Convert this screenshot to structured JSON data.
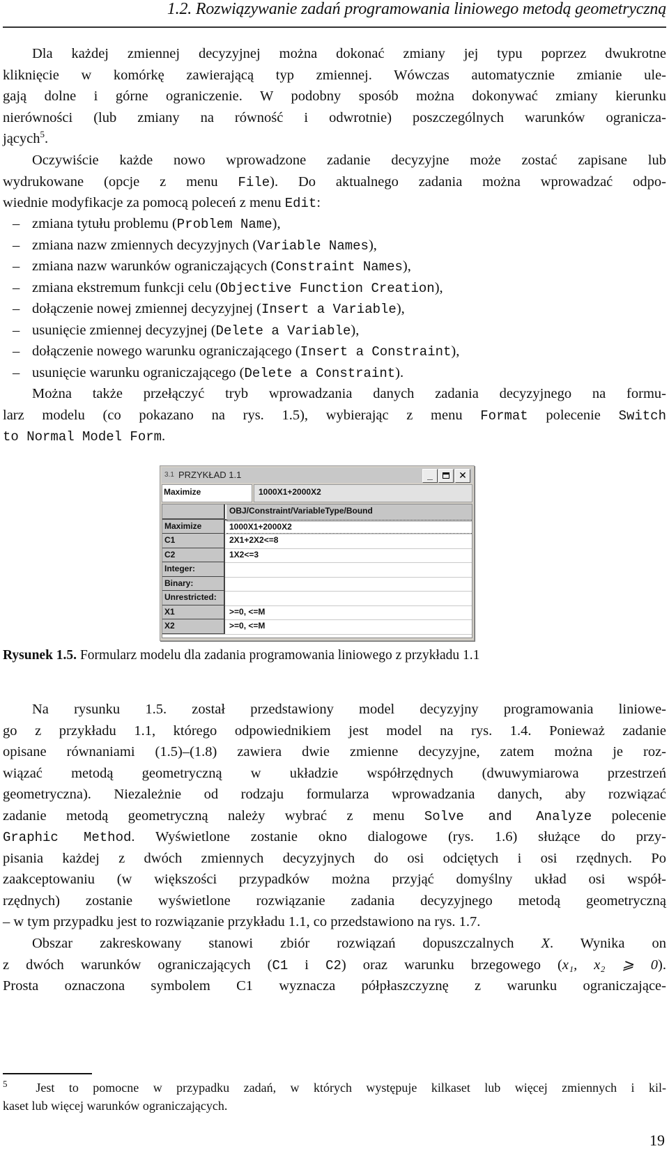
{
  "header": {
    "title": "1.2. Rozwiązywanie zadań programowania liniowego metodą geometryczną"
  },
  "para1": {
    "lines": [
      "Dla każdej zmiennej decyzyjnej można dokonać zmiany jej typu poprzez dwukrotne",
      "kliknięcie w komórkę zawierającą typ zmiennej. Wówczas automatycznie zmianie ule-",
      "gają dolne i górne ograniczenie. W podobny sposób można dokonywać zmiany kierunku",
      "nierówności (lub zmiany na równość i odwrotnie) poszczególnych warunków ogranicza-"
    ],
    "last_line": "jących",
    "footnote_ref": "5",
    "last_line_end": "."
  },
  "para2": {
    "line1": "Oczywiście każde nowo wprowadzone zadanie decyzyjne może zostać zapisane lub",
    "line2_a": "wydrukowane (opcje z menu ",
    "line2_code": "File",
    "line2_b": "). Do aktualnego zadania można wprowadzać odpo-",
    "line3_a": "wiednie modyfikacje za pomocą poleceń z menu ",
    "line3_code": "Edit",
    "line3_b": ":"
  },
  "edit_list": [
    {
      "text": "zmiana tytułu problemu (",
      "code": "Problem Name",
      "end": "),"
    },
    {
      "text": "zmiana nazw zmiennych decyzyjnych (",
      "code": "Variable Names",
      "end": "),"
    },
    {
      "text": "zmiana nazw warunków ograniczających (",
      "code": "Constraint Names",
      "end": "),"
    },
    {
      "text": "zmiana ekstremum funkcji celu (",
      "code": "Objective Function Creation",
      "end": "),"
    },
    {
      "text": "dołączenie nowej zmiennej decyzyjnej (",
      "code": "Insert a Variable",
      "end": "),"
    },
    {
      "text": "usunięcie zmiennej decyzyjnej (",
      "code": "Delete a Variable",
      "end": "),"
    },
    {
      "text": "dołączenie nowego warunku ograniczającego (",
      "code": "Insert a Constraint",
      "end": "),"
    },
    {
      "text": "usunięcie warunku ograniczającego (",
      "code": "Delete a Constraint",
      "end": ")."
    }
  ],
  "list_dash": "–",
  "para3": {
    "line1": "Można także przełączyć tryb wprowadzania danych zadania decyzyjnego na formu-",
    "line2_a": "larz modelu (co pokazano na rys. 1.5), wybierając z menu ",
    "line2_code1": "Format",
    "line2_b": " polecenie ",
    "line2_code2": "Switch",
    "line3_code": "to Normal Model Form",
    "line3_end": "."
  },
  "window": {
    "icon": "3.1",
    "title": "PRZYKŁAD 1.1",
    "buttons": {
      "minimize": "_",
      "close": "✕"
    },
    "objective_label": "Maximize",
    "objective_value": "1000X1+2000X2",
    "grid_header": "OBJ/Constraint/VariableType/Bound",
    "rows": [
      {
        "label": "Maximize",
        "value": "1000X1+2000X2"
      },
      {
        "label": "C1",
        "value": "2X1+2X2<=8"
      },
      {
        "label": "C2",
        "value": "1X2<=3"
      },
      {
        "label": "Integer:",
        "value": ""
      },
      {
        "label": "Binary:",
        "value": ""
      },
      {
        "label": "Unrestricted:",
        "value": ""
      },
      {
        "label": "X1",
        "value": ">=0, <=M"
      },
      {
        "label": "X2",
        "value": ">=0, <=M"
      }
    ]
  },
  "caption": {
    "label": "Rysunek 1.5.",
    "text": " Formularz modelu dla zadania programowania liniowego z przykładu 1.1"
  },
  "para4": {
    "line1": "Na rysunku 1.5. został przedstawiony model decyzyjny programowania liniowe-",
    "line2": "go z przykładu 1.1, którego odpowiednikiem jest model na rys. 1.4. Ponieważ zadanie",
    "line3": "opisane równaniami (1.5)–(1.8) zawiera dwie zmienne decyzyjne, zatem można je roz-",
    "line4": "wiązać metodą geometryczną w układzie współrzędnych (dwuwymiarowa przestrzeń",
    "line5": "geometryczna). Niezależnie od rodzaju formularza wprowadzania danych, aby rozwiązać",
    "line6_a": "zadanie metodą geometryczną należy wybrać z menu ",
    "line6_code": "Solve and Analyze",
    "line6_b": " polecenie",
    "line7_code": "Graphic Method",
    "line7_b": ". Wyświetlone zostanie okno dialogowe (rys. 1.6) służące do przy-",
    "line8": "pisania każdej z dwóch zmiennych decyzyjnych do osi odciętych i osi rzędnych. Po",
    "line9": "zaakceptowaniu (w większości przypadków można przyjąć domyślny układ osi współ-",
    "line10": "rzędnych) zostanie wyświetlone rozwiązanie zadania decyzyjnego metodą geometryczną",
    "line11": "– w tym przypadku jest to rozwiązanie przykładu 1.1, co przedstawiono na rys. 1.7."
  },
  "para5": {
    "line1_a": "Obszar zakreskowany stanowi zbiór rozwiązań dopuszczalnych ",
    "line1_var": "X",
    "line1_b": ". Wynika on",
    "line2_a": "z dwóch warunków ograniczających (",
    "line2_code1": "C1",
    "line2_mid": " i ",
    "line2_code2": "C2",
    "line2_b": ") oraz warunku brzegowego (",
    "line2_math": "x₁, x₂ ⩾ 0",
    "line2_end": ").",
    "line3": "Prosta oznaczona symbolem C1 wyznacza półpłaszczyznę z warunku ograniczające-"
  },
  "footnote": {
    "mark": "5",
    "line1": "Jest to pomocne w przypadku zadań, w których występuje kilkaset lub więcej zmiennych i kil-",
    "line2": "kaset lub więcej warunków ograniczających."
  },
  "page_number": "19"
}
